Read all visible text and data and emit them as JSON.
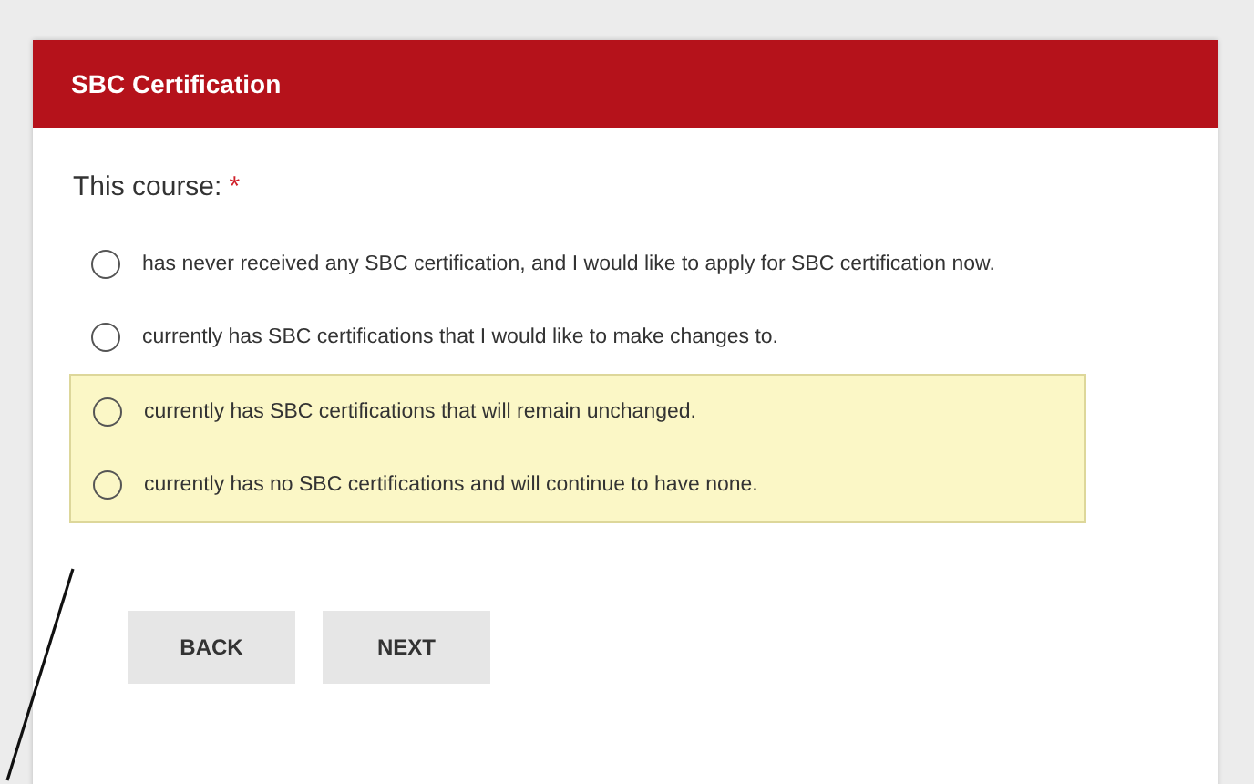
{
  "card": {
    "title": "SBC Certification"
  },
  "question": {
    "label": "This course:",
    "required_mark": "*"
  },
  "options": [
    {
      "label": "has never received any SBC certification, and I would like to apply for SBC certification now.",
      "selected": false,
      "highlighted": false
    },
    {
      "label": "currently has SBC certifications that I would like to make changes to.",
      "selected": false,
      "highlighted": false
    },
    {
      "label": "currently has SBC certifications that will remain unchanged.",
      "selected": false,
      "highlighted": true
    },
    {
      "label": "currently has no SBC certifications and will continue to have none.",
      "selected": false,
      "highlighted": true
    }
  ],
  "buttons": [
    {
      "label": "BACK"
    },
    {
      "label": "NEXT"
    }
  ]
}
